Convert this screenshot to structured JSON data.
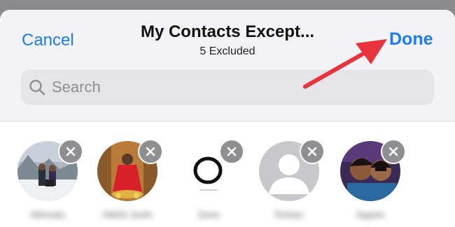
{
  "header": {
    "cancel_label": "Cancel",
    "title": "My Contacts Except...",
    "subtitle": "5 Excluded",
    "done_label": "Done"
  },
  "search": {
    "placeholder": "Search"
  },
  "contacts": [
    {
      "name": "Nimrata",
      "avatar": "photo-snow-group"
    },
    {
      "name": "Nikhil Joshi",
      "avatar": "photo-girl-red-dress"
    },
    {
      "name": "Dora",
      "avatar": "photo-black-ring"
    },
    {
      "name": "Rohan",
      "avatar": "default-person"
    },
    {
      "name": "Appee",
      "avatar": "photo-selfie-two"
    }
  ],
  "colors": {
    "accent": "#1a7cf5",
    "arrow": "#e8323c"
  }
}
